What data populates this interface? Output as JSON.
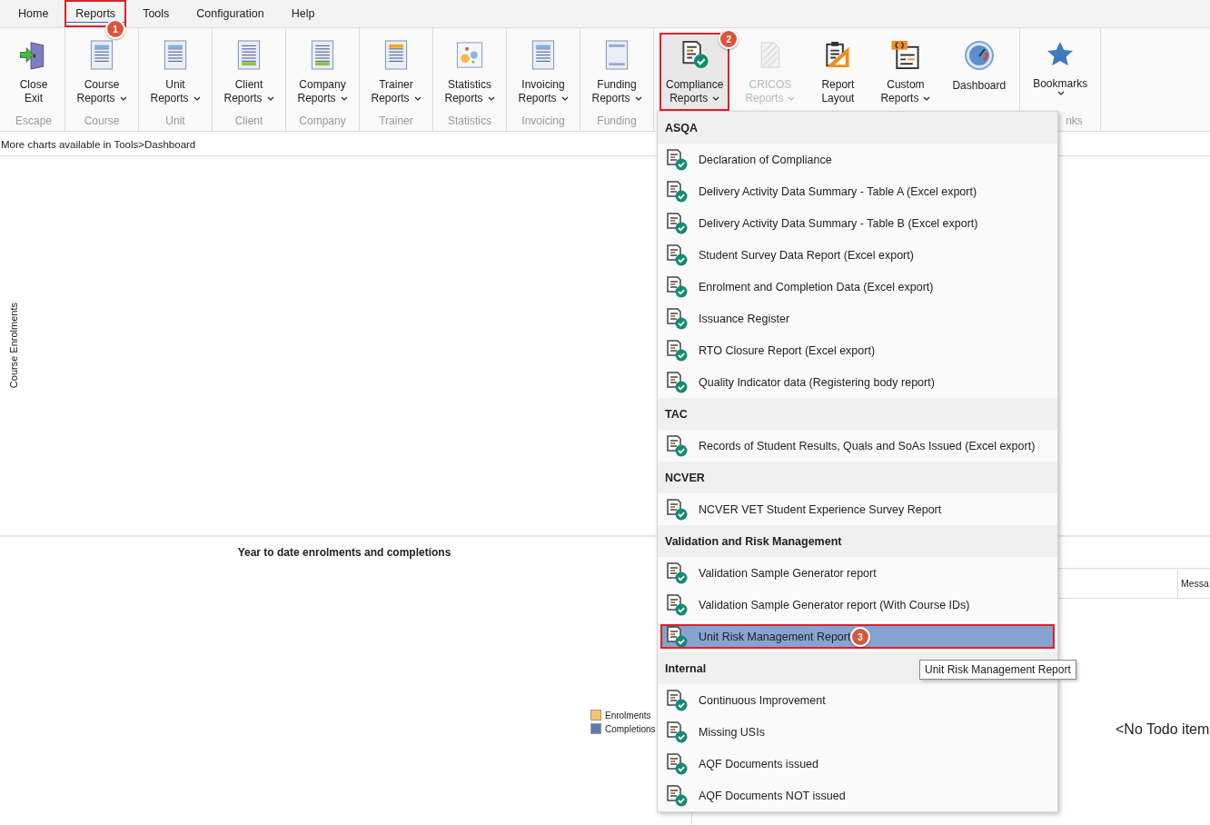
{
  "menu_bar": {
    "tabs": [
      {
        "label": "Home",
        "selected": false
      },
      {
        "label": "Reports",
        "selected": true,
        "callout": "1"
      },
      {
        "label": "Tools",
        "selected": false
      },
      {
        "label": "Configuration",
        "selected": false
      },
      {
        "label": "Help",
        "selected": false
      }
    ]
  },
  "ribbon": {
    "groups": [
      {
        "label": "Escape",
        "buttons": [
          {
            "lines": [
              "Close",
              "Exit"
            ],
            "dropdown": false,
            "disabled": false,
            "pressed": false
          }
        ]
      },
      {
        "label": "Course",
        "buttons": [
          {
            "lines": [
              "Course",
              "Reports"
            ],
            "dropdown": true,
            "disabled": false,
            "pressed": false
          }
        ]
      },
      {
        "label": "Unit",
        "buttons": [
          {
            "lines": [
              "Unit",
              "Reports"
            ],
            "dropdown": true,
            "disabled": false,
            "pressed": false
          }
        ]
      },
      {
        "label": "Client",
        "buttons": [
          {
            "lines": [
              "Client",
              "Reports"
            ],
            "dropdown": true,
            "disabled": false,
            "pressed": false
          }
        ]
      },
      {
        "label": "Company",
        "buttons": [
          {
            "lines": [
              "Company",
              "Reports"
            ],
            "dropdown": true,
            "disabled": false,
            "pressed": false
          }
        ]
      },
      {
        "label": "Trainer",
        "buttons": [
          {
            "lines": [
              "Trainer",
              "Reports"
            ],
            "dropdown": true,
            "disabled": false,
            "pressed": false
          }
        ]
      },
      {
        "label": "Statistics",
        "buttons": [
          {
            "lines": [
              "Statistics",
              "Reports"
            ],
            "dropdown": true,
            "disabled": false,
            "pressed": false
          }
        ]
      },
      {
        "label": "Invoicing",
        "buttons": [
          {
            "lines": [
              "Invoicing",
              "Reports"
            ],
            "dropdown": true,
            "disabled": false,
            "pressed": false
          }
        ]
      },
      {
        "label": "Funding",
        "buttons": [
          {
            "lines": [
              "Funding",
              "Reports"
            ],
            "dropdown": true,
            "disabled": false,
            "pressed": false
          }
        ]
      },
      {
        "buttons": [
          {
            "lines": [
              "Compliance",
              "Reports"
            ],
            "dropdown": true,
            "disabled": false,
            "pressed": true,
            "callout": "2"
          },
          {
            "lines": [
              "CRICOS",
              "Reports"
            ],
            "dropdown": true,
            "disabled": true,
            "pressed": false
          },
          {
            "lines": [
              "Report",
              "Layout"
            ],
            "dropdown": false,
            "disabled": false,
            "pressed": false
          },
          {
            "lines": [
              "Custom",
              "Reports"
            ],
            "dropdown": true,
            "disabled": false,
            "pressed": false
          },
          {
            "lines": [
              "Dashboard"
            ],
            "dropdown": false,
            "disabled": false,
            "pressed": false
          }
        ]
      },
      {
        "label": "nks",
        "buttons": [
          {
            "lines": [
              "Bookmarks"
            ],
            "dropdown": true,
            "disabled": false,
            "pressed": false
          }
        ]
      }
    ]
  },
  "info_text": "More charts available in Tools>Dashboard",
  "enrolments_chart": {
    "ylabel": "Course Enrolments"
  },
  "ytd_chart": {
    "title": "Year to date enrolments and completions",
    "legend": [
      {
        "label": "Enrolments",
        "color": "#f9c56b"
      },
      {
        "label": "Completions",
        "color": "#5b7bb3"
      }
    ]
  },
  "todo_panel": {
    "columns": [
      "Messa"
    ],
    "empty_text": "<No Todo item"
  },
  "dropdown": {
    "sections": [
      {
        "title": "ASQA",
        "items": [
          {
            "label": "Declaration of Compliance",
            "selected": false
          },
          {
            "label": "Delivery Activity Data Summary - Table A (Excel export)",
            "selected": false
          },
          {
            "label": "Delivery Activity Data Summary - Table B (Excel export)",
            "selected": false
          },
          {
            "label": "Student Survey Data Report (Excel export)",
            "selected": false
          },
          {
            "label": "Enrolment and Completion Data (Excel export)",
            "selected": false
          },
          {
            "label": "Issuance Register",
            "selected": false
          },
          {
            "label": "RTO Closure Report (Excel export)",
            "selected": false
          },
          {
            "label": "Quality Indicator data (Registering body report)",
            "selected": false
          }
        ]
      },
      {
        "title": "TAC",
        "items": [
          {
            "label": "Records of Student Results, Quals and SoAs Issued (Excel export)",
            "selected": false
          }
        ]
      },
      {
        "title": "NCVER",
        "items": [
          {
            "label": "NCVER VET Student Experience Survey Report",
            "selected": false
          }
        ]
      },
      {
        "title": "Validation and Risk Management",
        "items": [
          {
            "label": "Validation Sample Generator report",
            "selected": false
          },
          {
            "label": "Validation Sample Generator report (With Course IDs)",
            "selected": false
          },
          {
            "label": "Unit Risk Management Report",
            "selected": true,
            "callout": "3"
          }
        ]
      },
      {
        "title": "Internal",
        "items": [
          {
            "label": "Continuous Improvement",
            "selected": false
          },
          {
            "label": "Missing USIs",
            "selected": false
          },
          {
            "label": "AQF Documents issued",
            "selected": false
          },
          {
            "label": "AQF Documents NOT issued",
            "selected": false
          }
        ]
      }
    ]
  },
  "tooltip": "Unit Risk Management Report"
}
